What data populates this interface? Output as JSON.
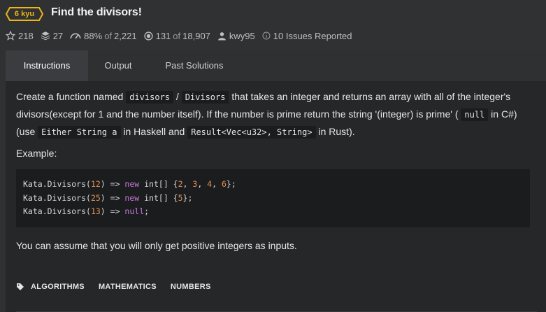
{
  "header": {
    "rank": "6 kyu",
    "title": "Find the divisors!",
    "stats": {
      "stars": "218",
      "collections": "27",
      "satisfaction": "88%",
      "satisfaction_of": "of",
      "satisfaction_votes": "2,221",
      "completed": "131",
      "completed_of": "of",
      "completed_total": "18,907",
      "author": "kwy95",
      "issues": "10 Issues Reported"
    }
  },
  "tabs": [
    {
      "label": "Instructions"
    },
    {
      "label": "Output"
    },
    {
      "label": "Past Solutions"
    }
  ],
  "instructions": {
    "p1_a": "Create a function named ",
    "p1_code1": "divisors",
    "p1_b": " / ",
    "p1_code2": "Divisors",
    "p1_c": " that takes an integer and returns an array with all of the integer's divisors(except for 1 and the number itself). If the number is prime return the string '(integer) is prime' ( ",
    "p1_code3": "null",
    "p1_d": " in C#) (use ",
    "p1_code4": "Either String a",
    "p1_e": " in Haskell and ",
    "p1_code5": "Result<Vec<u32>, String>",
    "p1_f": " in Rust).",
    "example_label": "Example:",
    "code_lines": [
      {
        "fn": "Kata.Divisors(",
        "arg": "12",
        "arrow": ") => ",
        "kw": "new",
        "type": " int[] {",
        "vals": [
          "2",
          "3",
          "4",
          "6"
        ],
        "end": "};"
      },
      {
        "fn": "Kata.Divisors(",
        "arg": "25",
        "arrow": ") => ",
        "kw": "new",
        "type": " int[] {",
        "vals": [
          "5"
        ],
        "end": "};"
      },
      {
        "fn": "Kata.Divisors(",
        "arg": "13",
        "arrow": ") => ",
        "kw": "null",
        "type": "",
        "vals": [],
        "end": ";"
      }
    ],
    "assume": "You can assume that you will only get positive integers as inputs."
  },
  "tags": [
    "ALGORITHMS",
    "MATHEMATICS",
    "NUMBERS"
  ],
  "colors": {
    "background": "#303133",
    "panel": "#262729",
    "rank_yellow": "#ecb613",
    "code_number": "#e5904e",
    "code_keyword": "#c678dd"
  }
}
